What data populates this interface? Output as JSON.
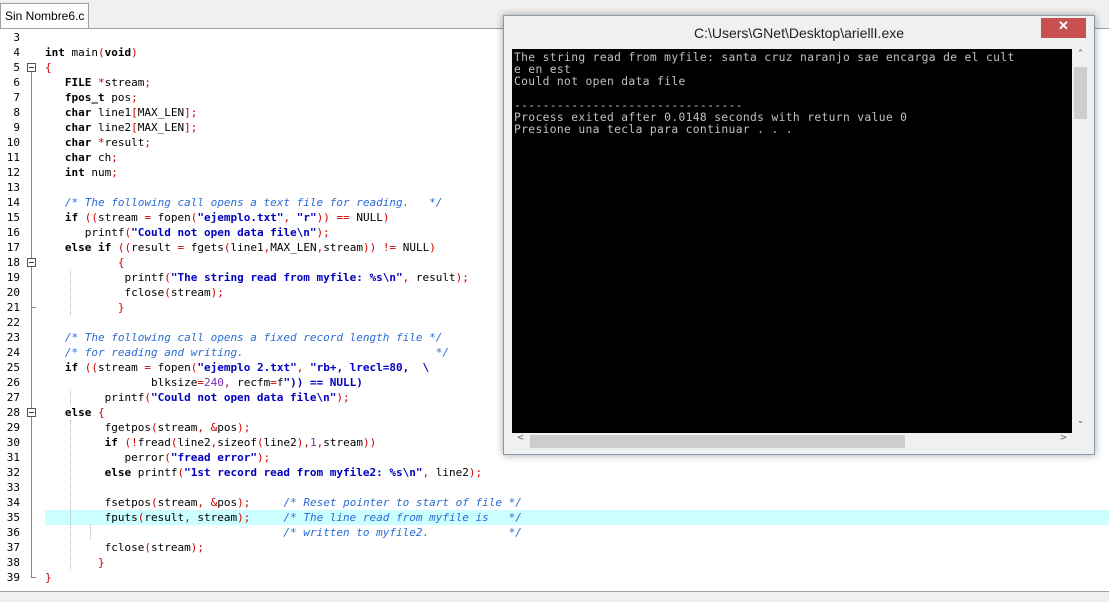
{
  "editor": {
    "tab_label": "Sin Nombre6.c",
    "line_numbers": [
      "3",
      "4",
      "5",
      "6",
      "7",
      "8",
      "9",
      "10",
      "11",
      "12",
      "13",
      "14",
      "15",
      "16",
      "17",
      "18",
      "19",
      "20",
      "21",
      "22",
      "23",
      "24",
      "25",
      "26",
      "27",
      "28",
      "29",
      "30",
      "31",
      "32",
      "33",
      "34",
      "35",
      "36",
      "37",
      "38",
      "39"
    ],
    "highlighted_line": "35"
  },
  "code_lines": [
    "",
    "int main(void)",
    "{",
    "   FILE *stream;",
    "   fpos_t pos;",
    "   char line1[MAX_LEN];",
    "   char line2[MAX_LEN];",
    "   char *result;",
    "   char ch;",
    "   int num;",
    "",
    "   /* The following call opens a text file for reading.   */",
    "   if ((stream = fopen(\"ejemplo.txt\", \"r\")) == NULL)",
    "      printf(\"Could not open data file\\n\");",
    "   else if ((result = fgets(line1,MAX_LEN,stream)) != NULL)",
    "           {",
    "            printf(\"The string read from myfile: %s\\n\", result);",
    "            fclose(stream);",
    "           }",
    "",
    "   /* The following call opens a fixed record length file */",
    "   /* for reading and writing.                             */",
    "   if ((stream = fopen(\"ejemplo 2.txt\", \"rb+, lrecl=80,  \\",
    "                blksize=240, recfm=f\")) == NULL)",
    "         printf(\"Could not open data file\\n\");",
    "   else {",
    "         fgetpos(stream, &pos);",
    "         if (!fread(line2,sizeof(line2),1,stream))",
    "            perror(\"fread error\");",
    "         else printf(\"1st record read from myfile2: %s\\n\", line2);",
    "",
    "         fsetpos(stream, &pos);     /* Reset pointer to start of file */",
    "         fputs(result, stream);     /* The line read from myfile is   */",
    "                                    /* written to myfile2.            */",
    "         fclose(stream);",
    "        }",
    "}"
  ],
  "console": {
    "title": "C:\\Users\\GNet\\Desktop\\ariellI.exe",
    "close_label": "✕",
    "lines": [
      "The string read from myfile: santa cruz naranjo sae encarga de el cult",
      "e en est",
      "Could not open data file",
      "",
      "--------------------------------",
      "Process exited after 0.0148 seconds with return value 0",
      "Presione una tecla para continuar . . ."
    ],
    "scroll_up_icon": "⌃",
    "scroll_down_icon": "⌄",
    "scroll_left_icon": "<",
    "scroll_right_icon": ">"
  },
  "colors": {
    "keyword": "#000000",
    "string": "#0000c0",
    "comment": "#2a6bd6",
    "symbol": "#d00000",
    "highlight_line": "#ccffff",
    "console_bg": "#000000",
    "console_text": "#c0c0c0",
    "close_button": "#c75050"
  }
}
